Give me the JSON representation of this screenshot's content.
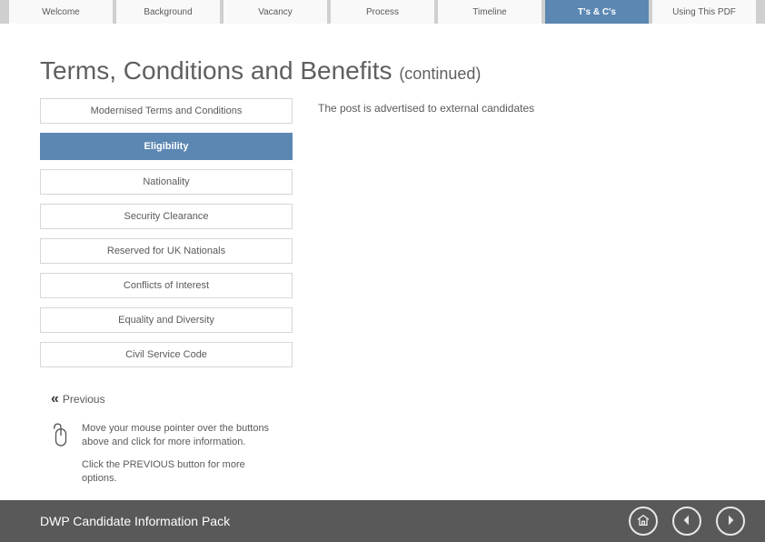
{
  "nav": {
    "tabs": [
      {
        "label": "Welcome",
        "active": false
      },
      {
        "label": "Background",
        "active": false
      },
      {
        "label": "Vacancy",
        "active": false
      },
      {
        "label": "Process",
        "active": false
      },
      {
        "label": "Timeline",
        "active": false
      },
      {
        "label": "T's & C's",
        "active": true
      },
      {
        "label": "Using This PDF",
        "active": false
      }
    ]
  },
  "page": {
    "title_main": "Terms, Conditions and Benefits ",
    "title_cont": "(continued)"
  },
  "sidebar": {
    "items": [
      {
        "label": "Modernised Terms and Conditions",
        "section": false
      },
      {
        "label": "Eligibility",
        "section": true
      },
      {
        "label": "Nationality",
        "section": false
      },
      {
        "label": "Security Clearance",
        "section": false
      },
      {
        "label": "Reserved for UK Nationals",
        "section": false
      },
      {
        "label": "Conflicts of Interest",
        "section": false
      },
      {
        "label": "Equality and Diversity",
        "section": false
      },
      {
        "label": "Civil Service Code",
        "section": false
      }
    ]
  },
  "main": {
    "body_text": "The post is advertised to external candidates"
  },
  "previous": {
    "label": "Previous"
  },
  "help": {
    "line1": "Move your mouse pointer over the buttons above and click for more information.",
    "line2": "Click the PREVIOUS button for more options."
  },
  "footer": {
    "title": "DWP Candidate Information Pack"
  }
}
